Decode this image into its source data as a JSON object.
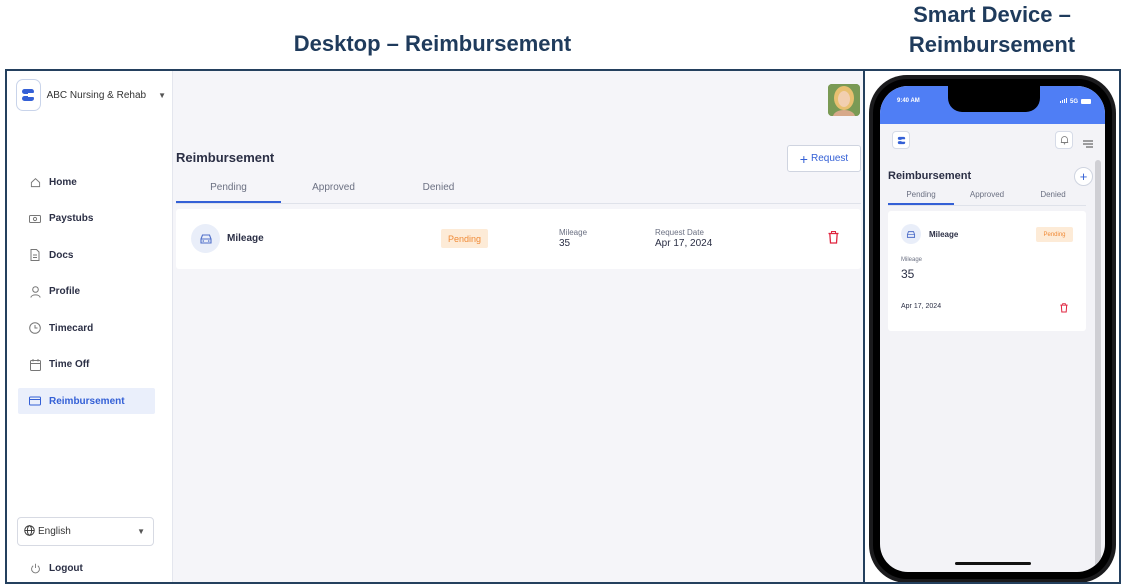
{
  "headings": {
    "desktop": "Desktop – Reimbursement",
    "mobile": "Smart Device – Reimbursement"
  },
  "org": {
    "name": "ABC Nursing & Rehab"
  },
  "sidebar": {
    "items": [
      {
        "label": "Home",
        "icon": "home-icon"
      },
      {
        "label": "Paystubs",
        "icon": "paystub-icon"
      },
      {
        "label": "Docs",
        "icon": "docs-icon"
      },
      {
        "label": "Profile",
        "icon": "profile-icon"
      },
      {
        "label": "Timecard",
        "icon": "clock-icon"
      },
      {
        "label": "Time Off",
        "icon": "calendar-icon"
      },
      {
        "label": "Reimbursement",
        "icon": "card-icon",
        "active": true
      }
    ],
    "language": "English",
    "logout": "Logout"
  },
  "page": {
    "title": "Reimbursement",
    "request_button": "Request",
    "tabs": [
      "Pending",
      "Approved",
      "Denied"
    ],
    "active_tab": "Pending"
  },
  "card": {
    "type": "Mileage",
    "status": "Pending",
    "mileage_label": "Mileage",
    "mileage_value": "35",
    "date_label": "Request Date",
    "date_value": "Apr 17, 2024"
  },
  "mobile": {
    "time": "9:40 AM",
    "signal": "5G",
    "title": "Reimbursement",
    "tabs": [
      "Pending",
      "Approved",
      "Denied"
    ],
    "card": {
      "type": "Mileage",
      "status": "Pending",
      "mileage_label": "Mileage",
      "mileage_value": "35",
      "date": "Apr 17, 2024"
    }
  },
  "colors": {
    "accent": "#3460d6",
    "heading": "#1f3b5c",
    "pending_bg": "#fdebd7",
    "pending_text": "#f08a36",
    "delete": "#e0243f",
    "status_bar": "#4f7ef5"
  }
}
